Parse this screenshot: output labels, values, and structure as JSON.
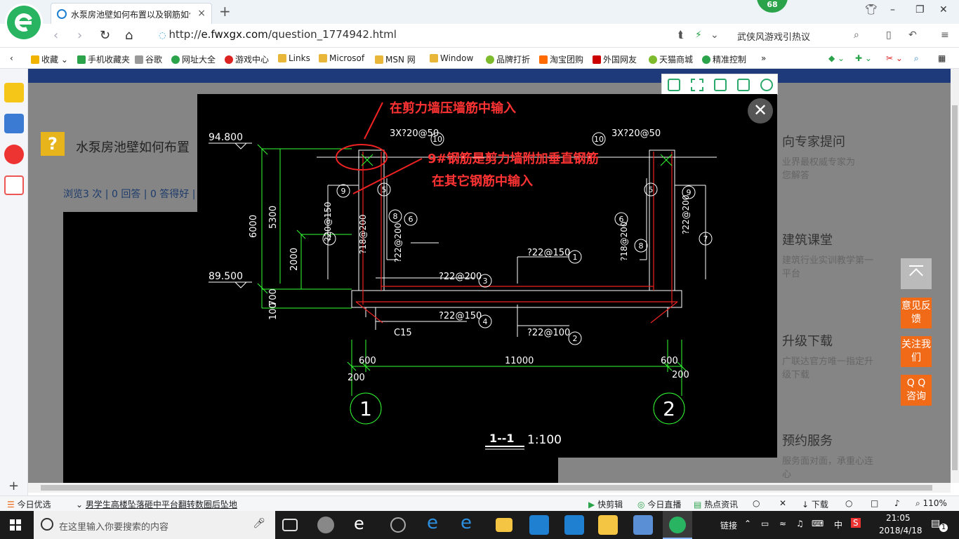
{
  "browser": {
    "tab_title": "水泵房池壁如何布置以及钢筋如何",
    "tab_close": "×",
    "new_tab": "+",
    "badge_count": "68",
    "url_prefix": "http://",
    "url_host": "e.fwxgx.com",
    "url_path": "/question_1774942.html",
    "search_hint": "武侠风游戏引热议"
  },
  "bookmarks": [
    {
      "label": "收藏",
      "color": "#f0b400"
    },
    {
      "label": "手机收藏夹",
      "color": "#2aa34a"
    },
    {
      "label": "谷歌",
      "color": "#888888"
    },
    {
      "label": "网址大全",
      "color": "#2aa34a"
    },
    {
      "label": "游戏中心",
      "color": "#d22"
    },
    {
      "label": "Links",
      "color": "#e8b73a"
    },
    {
      "label": "Microsof",
      "color": "#e8b73a"
    },
    {
      "label": "MSN 网",
      "color": "#e8b73a"
    },
    {
      "label": "Window",
      "color": "#e8b73a"
    },
    {
      "label": "品牌打折",
      "color": "#7dbb2c"
    },
    {
      "label": "淘宝团购",
      "color": "#ff6a00"
    },
    {
      "label": "外国网友",
      "color": "#c00"
    },
    {
      "label": "天猫商城",
      "color": "#7dbb2c"
    },
    {
      "label": "精准控制",
      "color": "#2aa34a"
    }
  ],
  "page": {
    "title": "水泵房池壁如何布置",
    "stats": "浏览3 次 | 0 回答 | 0 答得好 |",
    "right_panel": [
      {
        "title": "向专家提问",
        "sub": "业界最权威专家为您解答"
      },
      {
        "title": "建筑课堂",
        "sub": "建筑行业实训教学第一平台"
      },
      {
        "title": "升级下载",
        "sub": "广联达官方唯一指定升级下载"
      },
      {
        "title": "预约服务",
        "sub": "服务面对面，承重心连心"
      }
    ],
    "float_buttons": [
      "意见反馈",
      "关注我们",
      "Q Q 咨询"
    ]
  },
  "drawing": {
    "annotation_1": "在剪力墙压墙筋中输入",
    "annotation_2": "9#钢筋是剪力墙附加垂直钢筋",
    "annotation_3": "在其它钢筋中输入",
    "elev_top": "94.800",
    "elev_bottom": "89.500",
    "dim_6000": "6000",
    "dim_5300": "5300",
    "dim_2000": "2000",
    "dim_700": "700",
    "dim_100": "100",
    "rebar_top_left": "3X?20@50",
    "rebar_top_right": "3X?20@50",
    "rebar_1": "?22@150",
    "rebar_2": "?22@100",
    "rebar_3": "?22@200",
    "rebar_4": "?22@150",
    "rebar_5": "?18@200",
    "rebar_6": "?22@200",
    "rebar_7": "?20@150",
    "rebar_8": "?18@200",
    "rebar_9": "?22@200",
    "c15": "C15",
    "dim_600_left": "600",
    "dim_11000": "11000",
    "dim_600_right": "600",
    "dim_200_left": "200",
    "dim_200_right": "200",
    "axis_1": "1",
    "axis_2": "2",
    "section_label": "1--1",
    "scale": "1:100",
    "bubble_1": "1",
    "bubble_2": "2",
    "bubble_3": "3",
    "bubble_4": "4",
    "bubble_5": "5",
    "bubble_6": "6",
    "bubble_7": "7",
    "bubble_8": "8",
    "bubble_9": "9",
    "bubble_10": "10"
  },
  "statusbar": {
    "left": "今日优选",
    "news": "男学生高楼坠落砸中平台翻转数圈后坠地",
    "quick_edit": "快剪辑",
    "live": "今日直播",
    "hot": "热点资讯",
    "download": "下载",
    "zoom": "110%"
  },
  "taskbar": {
    "search_placeholder": "在这里输入你要搜索的内容",
    "link_label": "链接",
    "ime": "中",
    "time": "21:05",
    "date": "2018/4/18",
    "notif_count": "1"
  }
}
